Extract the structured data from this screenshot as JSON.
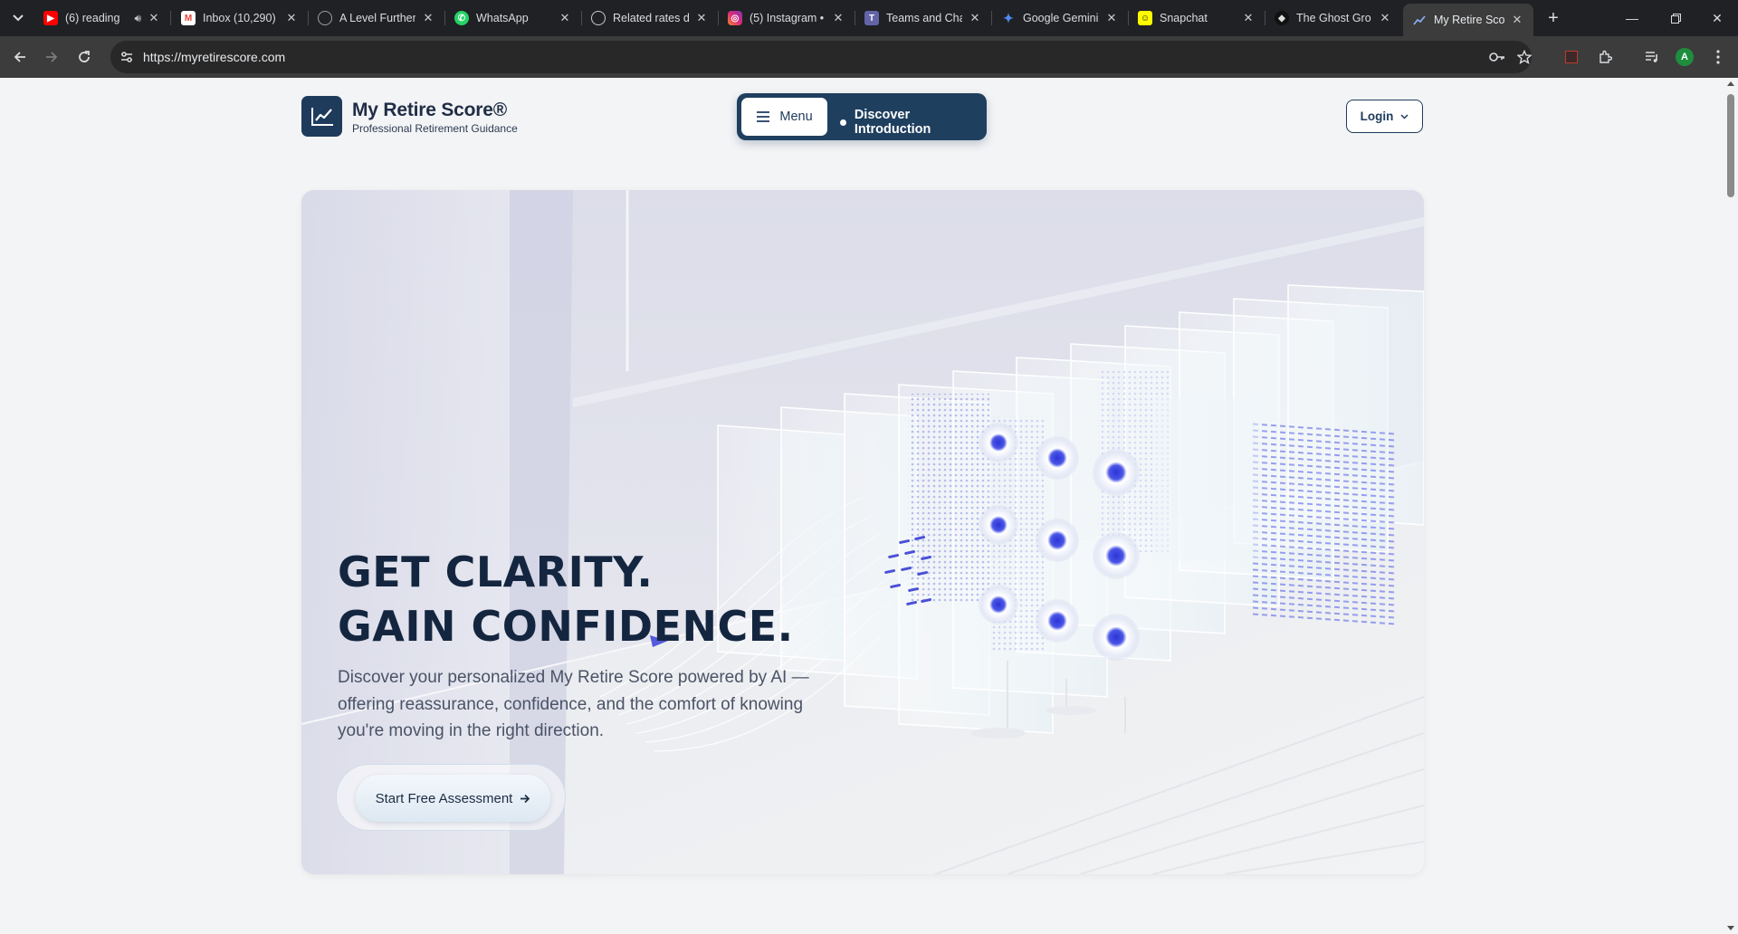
{
  "browser": {
    "tabs": [
      {
        "title": "(6) reading",
        "icon": "youtube-icon",
        "icon_color": "#ff0000",
        "audio": true
      },
      {
        "title": "Inbox (10,290)",
        "icon": "gmail-icon",
        "icon_color": "#ea4335"
      },
      {
        "title": "A Level Further",
        "icon": "globe-icon",
        "icon_color": "#9aa0a6"
      },
      {
        "title": "WhatsApp",
        "icon": "whatsapp-icon",
        "icon_color": "#25d366"
      },
      {
        "title": "Related rates d",
        "icon": "openai-icon",
        "icon_color": "#c8cacd"
      },
      {
        "title": "(5) Instagram •",
        "icon": "instagram-icon",
        "icon_color": "#e1306c"
      },
      {
        "title": "Teams and Cha",
        "icon": "teams-icon",
        "icon_color": "#6264a7"
      },
      {
        "title": "Google Gemini",
        "icon": "gemini-icon",
        "icon_color": "#4e8cf7"
      },
      {
        "title": "Snapchat",
        "icon": "snapchat-icon",
        "icon_color": "#fffc00"
      },
      {
        "title": "The Ghost Gro",
        "icon": "ghost-icon",
        "icon_color": "#111111"
      },
      {
        "title": "My Retire Scor",
        "icon": "chart-icon",
        "icon_color": "#8ab4f8",
        "active": true
      }
    ],
    "url": "https://myretirescore.com",
    "profile_initial": "A"
  },
  "header": {
    "brand_name": "My Retire Score®",
    "brand_tagline": "Professional Retirement Guidance",
    "menu_label": "Menu",
    "discover_label": "Discover Introduction",
    "login_label": "Login"
  },
  "hero": {
    "headline_line1": "GET CLARITY.",
    "headline_line2": "GAIN CONFIDENCE.",
    "subtext_line1": "Discover your personalized My Retire Score powered by AI —",
    "subtext_line2": "offering reassurance, confidence, and the comfort of knowing",
    "subtext_line3": "you're moving in the right direction.",
    "cta_label": "Start Free Assessment"
  },
  "colors": {
    "brand_navy": "#1f3b5c",
    "headline": "#14263f",
    "accent_blue": "#3a3fd8"
  }
}
